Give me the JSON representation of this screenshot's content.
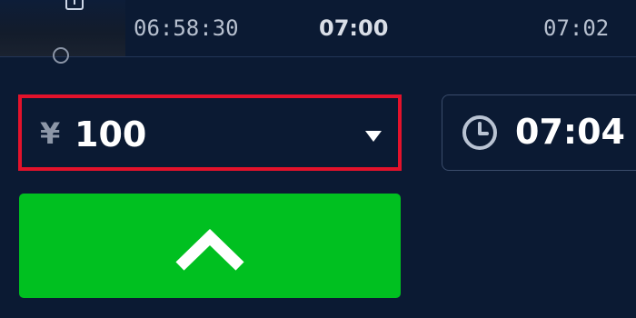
{
  "timeline": {
    "ticks": [
      "06:58:30",
      "07:00",
      "07:02"
    ]
  },
  "trade": {
    "currency_symbol": "¥",
    "amount": "100",
    "expiry_time": "07:04"
  },
  "icons": {
    "amount_dropdown": "chevron-down-icon",
    "expiry": "clock-icon",
    "up_button": "chevron-up-icon",
    "thumbnail": "tray-icon"
  },
  "colors": {
    "background": "#0b1a33",
    "highlight_border": "#e3122b",
    "up_button": "#00c020",
    "text": "#ffffff"
  }
}
